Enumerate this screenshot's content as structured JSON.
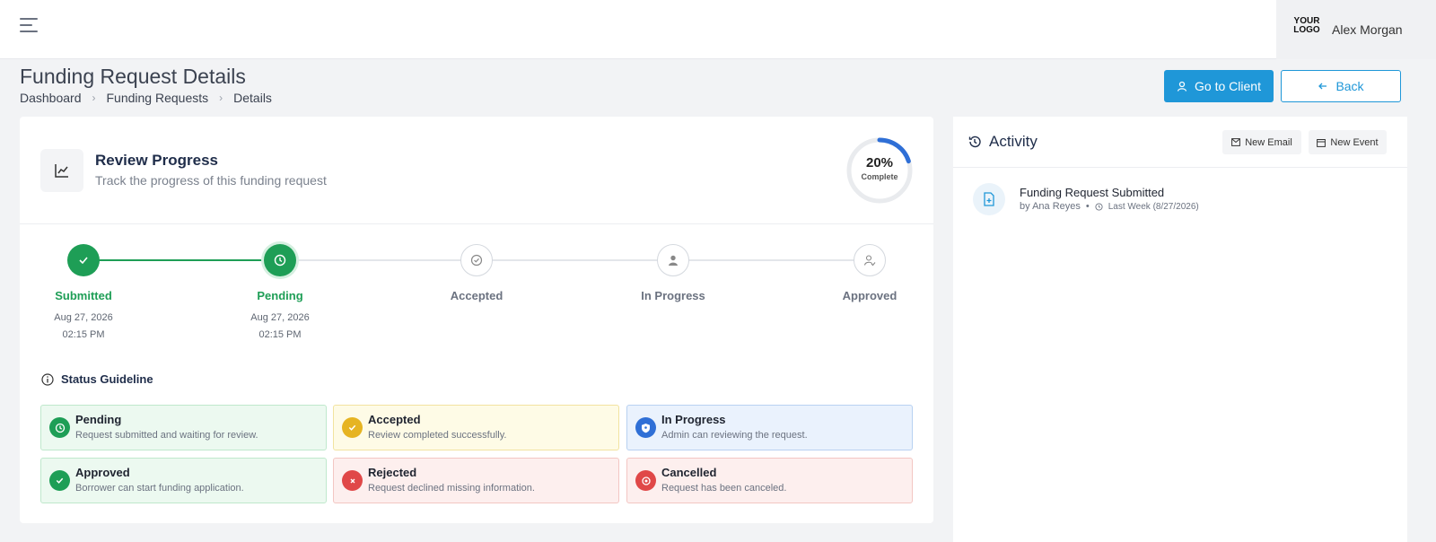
{
  "header": {
    "menu_icon": "hamburger-menu-icon",
    "logo_text": "YOUR LOGO",
    "user_name": "Alex Morgan"
  },
  "page": {
    "title": "Funding Request Details",
    "breadcrumb": [
      "Dashboard",
      "Funding Requests",
      "Details"
    ],
    "go_to_client_label": "Go to Client",
    "back_label": "Back"
  },
  "review": {
    "title": "Review Progress",
    "subtitle": "Track the progress of this funding request",
    "progress_percent": "20%",
    "progress_label": "Complete",
    "progress_value": 0.2,
    "accent_color": "#1e9e56",
    "ring_color": "#2f6fd6"
  },
  "steps": [
    {
      "label": "Submitted",
      "date": "Aug 27, 2026",
      "time": "02:15 PM",
      "state": "done"
    },
    {
      "label": "Pending",
      "date": "Aug 27, 2026",
      "time": "02:15 PM",
      "state": "current"
    },
    {
      "label": "Accepted",
      "date": "",
      "time": "",
      "state": "todo"
    },
    {
      "label": "In Progress",
      "date": "",
      "time": "",
      "state": "todo"
    },
    {
      "label": "Approved",
      "date": "",
      "time": "",
      "state": "todo"
    }
  ],
  "guideline": {
    "title": "Status Guideline",
    "items": [
      {
        "title": "Pending",
        "desc": "Request submitted and waiting for review.",
        "icon": "clock-icon",
        "color": "#1e9e56"
      },
      {
        "title": "Accepted",
        "desc": "Review completed successfully.",
        "icon": "check-icon",
        "color": "#e6b422"
      },
      {
        "title": "In Progress",
        "desc": "Admin can reviewing the request.",
        "icon": "shield-icon",
        "color": "#2f6fd6"
      },
      {
        "title": "Approved",
        "desc": "Borrower can start funding application.",
        "icon": "check-icon",
        "color": "#1e9e56"
      },
      {
        "title": "Rejected",
        "desc": "Request declined missing information.",
        "icon": "x-icon",
        "color": "#e04848"
      },
      {
        "title": "Cancelled",
        "desc": "Request has been canceled.",
        "icon": "stop-icon",
        "color": "#e04848"
      }
    ]
  },
  "activity": {
    "title": "Activity",
    "new_email_label": "New Email",
    "new_event_label": "New Event",
    "items": [
      {
        "title": "Funding Request Submitted",
        "by": "by Ana Reyes",
        "separator": "•",
        "time": "Last Week (8/27/2026)"
      }
    ]
  }
}
